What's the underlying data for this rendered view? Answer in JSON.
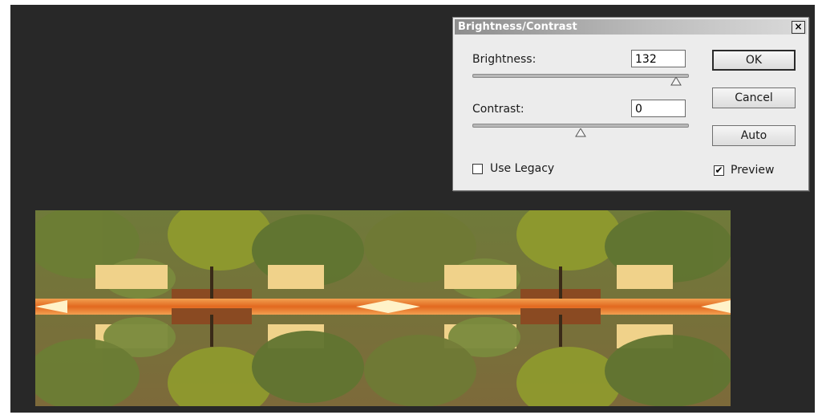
{
  "dialog": {
    "title": "Brightness/Contrast",
    "close_symbol": "×",
    "brightness": {
      "label": "Brightness:",
      "value": "132",
      "slider_fraction": 0.94
    },
    "contrast": {
      "label": "Contrast:",
      "value": "0",
      "slider_fraction": 0.5
    },
    "buttons": {
      "ok": "OK",
      "cancel": "Cancel",
      "auto": "Auto"
    },
    "use_legacy": {
      "label": "Use Legacy",
      "checked": false
    },
    "preview": {
      "label": "Preview",
      "checked": true,
      "check_symbol": "✔"
    }
  },
  "colors": {
    "canvas_background": "#282828",
    "dialog_background": "#ececec",
    "orange_band": "#e2681f"
  }
}
